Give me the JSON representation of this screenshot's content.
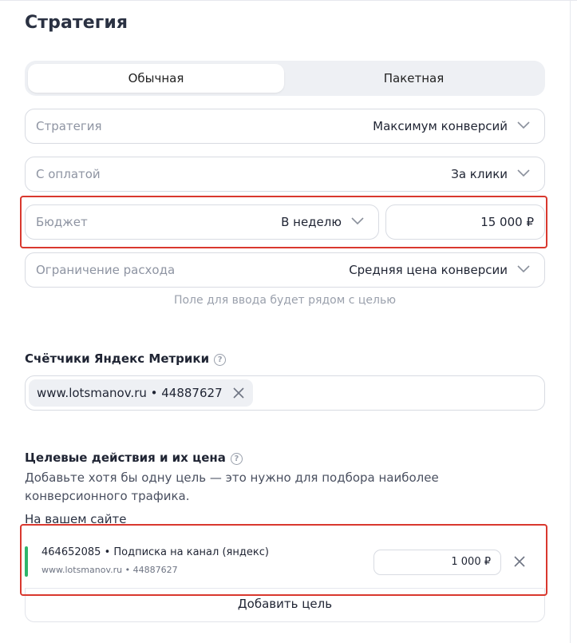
{
  "title": "Стратегия",
  "mode_tabs": {
    "regular": "Обычная",
    "package": "Пакетная"
  },
  "strategy": {
    "label": "Стратегия",
    "value": "Максимум конверсий"
  },
  "payment": {
    "label": "С оплатой",
    "value": "За клики"
  },
  "budget": {
    "label": "Бюджет",
    "period": "В неделю",
    "amount": "15 000  ₽"
  },
  "spend_limit": {
    "label": "Ограничение расхода",
    "value": "Средняя цена конверсии"
  },
  "hint": "Поле для ввода будет рядом с целью",
  "counters": {
    "title": "Счётчики Яндекс Метрики",
    "help_glyph": "?",
    "chip": "www.lotsmanov.ru • 44887627"
  },
  "goals": {
    "title": "Целевые действия и их цена",
    "help_glyph": "?",
    "description": "Добавьте хотя бы одну цель — это нужно для подбора наиболее конверсионного трафика.",
    "on_site_label": "На вашем сайте",
    "items": [
      {
        "name": "464652085 • Подписка на канал (яндекс)",
        "site": "www.lotsmanov.ru • 44887627",
        "price": "1 000  ₽",
        "status_color": "#2fb56a"
      }
    ],
    "add_label": "Добавить цель"
  },
  "colors": {
    "highlight": "#d9382e",
    "accent_green": "#2fb56a"
  },
  "icons": {
    "dropdown": "chevron-down-icon",
    "remove": "close-icon",
    "help": "question-circle-icon"
  }
}
